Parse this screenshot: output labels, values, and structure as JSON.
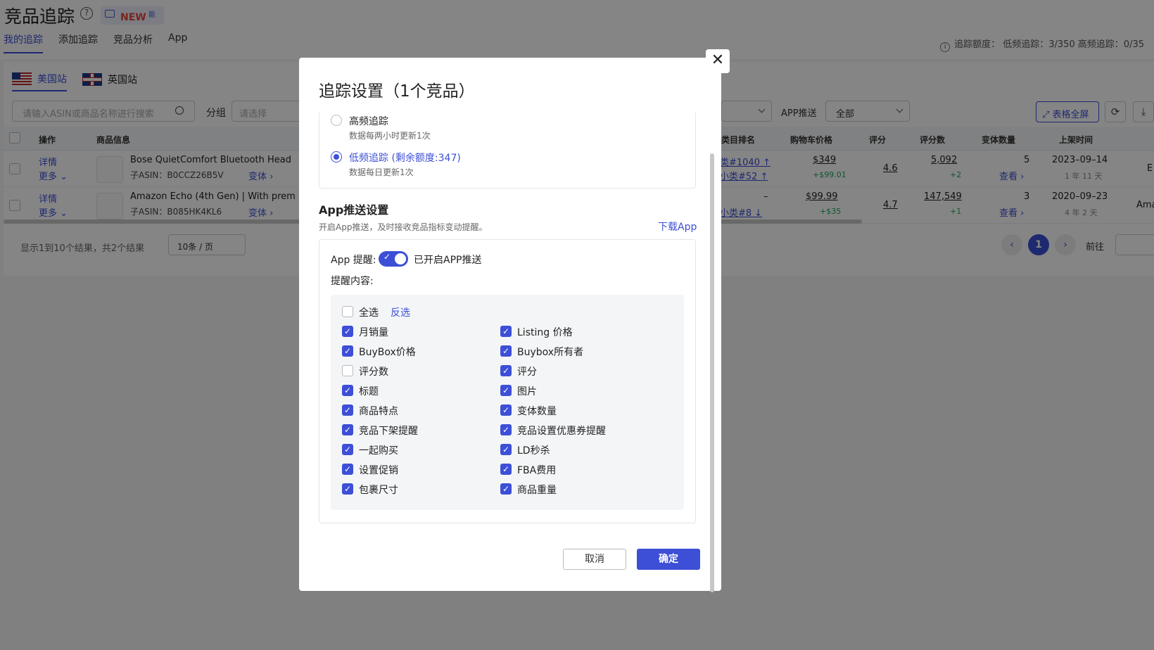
{
  "page": {
    "title": "竞品追踪",
    "help_glyph": "?",
    "new_badge": "NEW",
    "new_badge_suffix": "能",
    "tabs": [
      "我的追踪",
      "添加追踪",
      "竞品分析",
      "App"
    ],
    "quota_icon": "i",
    "quota_text": "追踪额度： 低频追踪：3/350 高频追踪：0/35"
  },
  "sites": [
    "美国站",
    "英国站"
  ],
  "filters": {
    "search_placeholder": "请输入ASIN或商品名称进行搜索",
    "group_label": "分组",
    "group_placeholder": "请选择",
    "app_push_label": "APP推送",
    "app_push_value": "全部",
    "fullscreen_label": "表格全屏",
    "refresh_glyph": "⟳",
    "download_glyph": "⤓"
  },
  "table": {
    "headers": [
      "操作",
      "商品信息",
      "类目排名",
      "购物车价格",
      "评分",
      "评分数",
      "变体数量",
      "上架时间"
    ],
    "rows": [
      {
        "action_detail": "详情",
        "action_more": "更多 ⌄",
        "title": "Bose QuietComfort Bluetooth Head",
        "asin": "子ASIN：B0CCZ26B5V",
        "variant_link": "变体 ›",
        "rank_main": "类#1040 ↑",
        "rank_sub": "小类#52 ↑",
        "price": "$349",
        "price_delta": "+$99.01",
        "rating": "4.6",
        "reviews": "5,092",
        "reviews_delta": "+2",
        "variants": "5",
        "variants_link": "查看 ›",
        "date": "2023–09–14",
        "age": "1 年 11 天",
        "extra": "E"
      },
      {
        "action_detail": "详情",
        "action_more": "更多 ⌄",
        "title": "Amazon Echo (4th Gen) | With prem",
        "asin": "子ASIN：B085HK4KL6",
        "variant_link": "变体 ›",
        "rank_main": "–",
        "rank_sub": "小类#8 ↓",
        "price": "$99.99",
        "price_delta": "+$35",
        "rating": "4.7",
        "reviews": "147,549",
        "reviews_delta": "+1",
        "variants": "3",
        "variants_link": "查看 ›",
        "date": "2020–09–23",
        "age": "4 年 2 天",
        "extra": "Ama"
      }
    ]
  },
  "pager": {
    "info": "显示1到10个结果，共2个结果",
    "page_size": "10条 / 页",
    "prev": "‹",
    "current": "1",
    "next": "›",
    "goto_label": "前往"
  },
  "modal": {
    "close_glyph": "✕",
    "title": "追踪设置（1个竞品）",
    "freq_high_label": "高频追踪",
    "freq_high_desc": "数据每两小时更新1次",
    "freq_low_label": "低频追踪 (剩余额度:347)",
    "freq_low_desc": "数据每日更新1次",
    "section_title": "App推送设置",
    "section_desc": "开启App推送，及时接收竞品指标变动提醒。",
    "download_app": "下载App",
    "reminder_label": "App 提醒:",
    "toggle_check": "✓",
    "toggle_status": "已开启APP推送",
    "content_label": "提醒内容:",
    "select_all": "全选",
    "invert": "反选",
    "items": [
      {
        "label": "月销量",
        "checked": true
      },
      {
        "label": "Listing 价格",
        "checked": true
      },
      {
        "label": "BuyBox价格",
        "checked": true
      },
      {
        "label": "Buybox所有者",
        "checked": true
      },
      {
        "label": "评分数",
        "checked": false
      },
      {
        "label": "评分",
        "checked": true
      },
      {
        "label": "标题",
        "checked": true
      },
      {
        "label": "图片",
        "checked": true
      },
      {
        "label": "商品特点",
        "checked": true
      },
      {
        "label": "变体数量",
        "checked": true
      },
      {
        "label": "竞品下架提醒",
        "checked": true
      },
      {
        "label": "竞品设置优惠券提醒",
        "checked": true
      },
      {
        "label": "一起购买",
        "checked": true
      },
      {
        "label": "LD秒杀",
        "checked": true
      },
      {
        "label": "设置促销",
        "checked": true
      },
      {
        "label": "FBA费用",
        "checked": true
      },
      {
        "label": "包裹尺寸",
        "checked": true
      },
      {
        "label": "商品重量",
        "checked": true
      }
    ],
    "cancel": "取消",
    "ok": "确定"
  },
  "colors": {
    "accent": "#3d4fd6",
    "up": "#1aa55a",
    "down": "#e8453c"
  }
}
